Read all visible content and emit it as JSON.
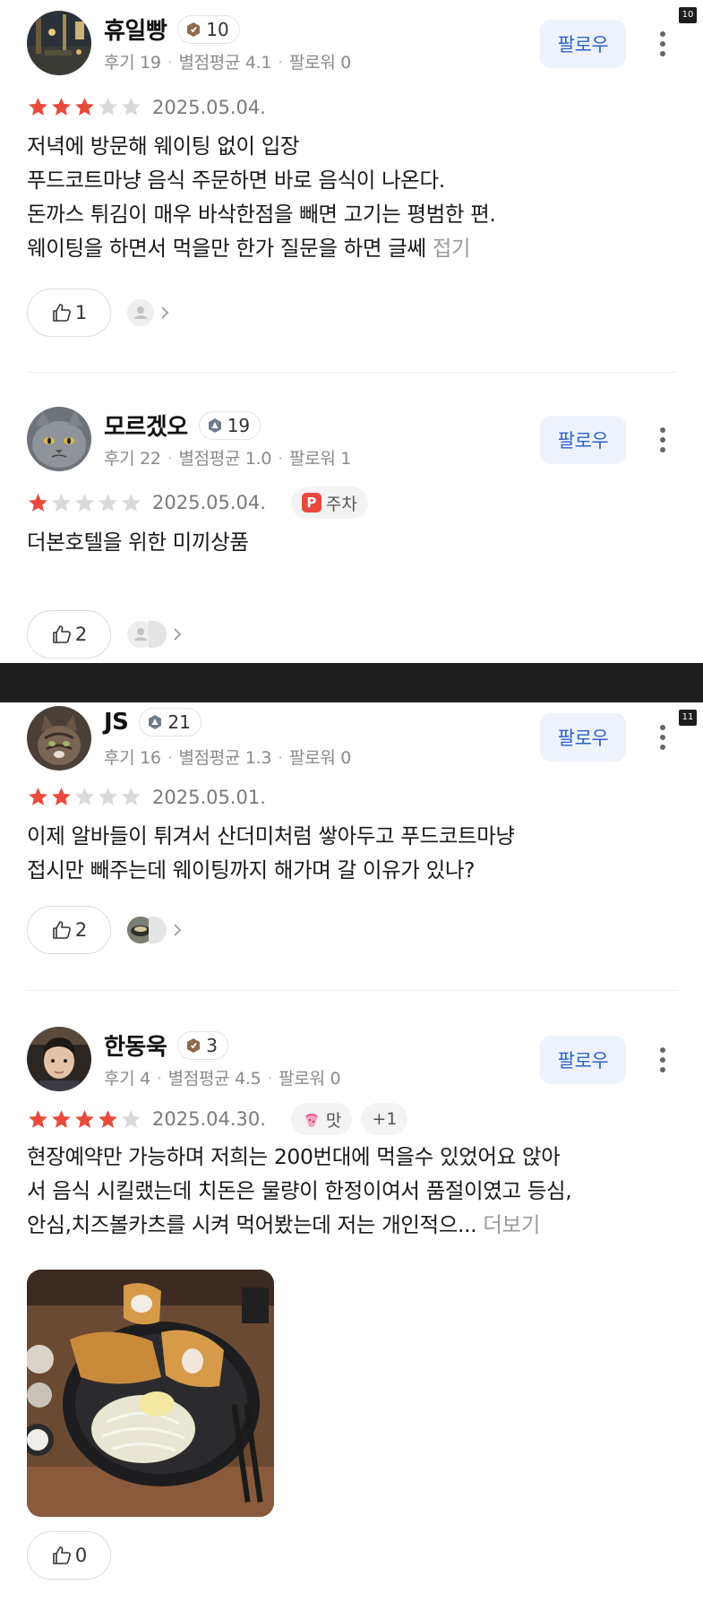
{
  "pages": [
    "10",
    "11"
  ],
  "reviews": [
    {
      "user": "휴일빵",
      "level": "10",
      "meta": {
        "reviews": "후기 19",
        "avg": "별점평균 4.1",
        "followers": "팔로워 0"
      },
      "follow": "팔로우",
      "stars": 3,
      "date": "2025.05.04.",
      "lines": [
        "저녁에 방문해 웨이팅 없이 입장",
        "푸드코트마냥 음식 주문하면 바로 음식이 나온다.",
        "돈까스 튀김이 매우 바삭한점을 빼면 고기는 평범한 편.",
        "웨이팅을 하면서 먹을만 한가 질문을 하면 글쎄"
      ],
      "fold": "접기",
      "likes": "1"
    },
    {
      "user": "모르겠오",
      "level": "19",
      "meta": {
        "reviews": "후기 22",
        "avg": "별점평균 1.0",
        "followers": "팔로워 1"
      },
      "follow": "팔로우",
      "stars": 1,
      "date": "2025.05.04.",
      "tag": "주차",
      "tag_icon": "P",
      "lines": [
        "더본호텔을 위한 미끼상품"
      ],
      "likes": "2"
    },
    {
      "user": "JS",
      "level": "21",
      "meta": {
        "reviews": "후기 16",
        "avg": "별점평균 1.3",
        "followers": "팔로워 0"
      },
      "follow": "팔로우",
      "stars": 2,
      "date": "2025.05.01.",
      "lines": [
        "이제 알바들이 튀겨서 산더미처럼 쌓아두고 푸드코트마냥",
        "접시만 빼주는데 웨이팅까지 해가며 갈 이유가 있나?"
      ],
      "likes": "2"
    },
    {
      "user": "한동욱",
      "level": "3",
      "meta": {
        "reviews": "후기 4",
        "avg": "별점평균 4.5",
        "followers": "팔로워 0"
      },
      "follow": "팔로우",
      "stars": 4,
      "date": "2025.04.30.",
      "tag": "맛",
      "extra": "+1",
      "lines": [
        "현장예약만 가능하며 저희는 200번대에 먹을수 있었어요 앉아",
        "서 음식 시킬랬는데 치돈은 물량이 한정이여서 품절이였고 등심,",
        "안심,치즈볼카츠를 시켜 먹어봤는데 저는 개인적으..."
      ],
      "more": "더보기",
      "likes": "0"
    }
  ],
  "colors": {
    "star_on": "#e84a3c",
    "star_off": "#d9d9d9",
    "follow_text": "#2e62c8",
    "follow_bg": "#eef3fb"
  }
}
